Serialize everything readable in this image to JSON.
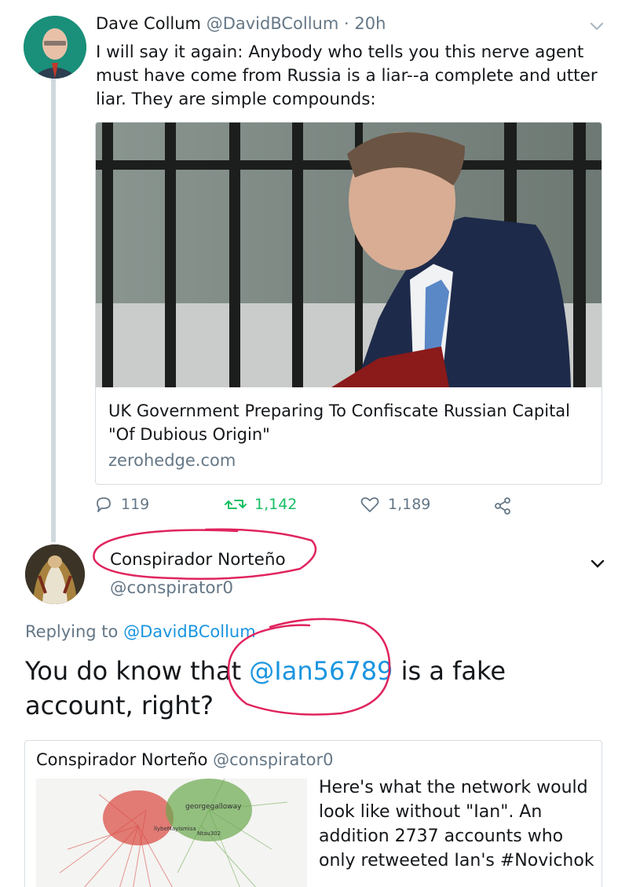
{
  "tweet": {
    "author_name": "Dave Collum",
    "author_handle": "@DavidBCollum",
    "dot": "·",
    "time": "20h",
    "text": "I will say it again: Anybody who tells you this nerve agent must have come from Russia is a liar--a complete and utter liar. They are simple compounds:",
    "card": {
      "title": "UK Government Preparing To Confiscate Russian Capital \"Of Dubious Origin\"",
      "domain": "zerohedge.com"
    },
    "actions": {
      "replies": "119",
      "retweets": "1,142",
      "likes": "1,189"
    }
  },
  "reply": {
    "author_name": "Conspirador Norteño",
    "author_handle": "@conspirator0",
    "replying_label": "Replying to ",
    "replying_handle": "@DavidBCollum",
    "text_before": "You do know that ",
    "mention": "@Ian56789",
    "text_after": " is a fake account, right?",
    "quoted": {
      "author_name": "Conspirador Norteño",
      "author_handle": "@conspirator0",
      "text": "Here's what the network would look like without \"Ian\". An addition 2737 accounts who only retweeted Ian's #Novichok",
      "image_labels": [
        "georgegalloway",
        "llybeMayIsmisa",
        "Ntau302"
      ]
    }
  },
  "colors": {
    "link": "#1b95e0",
    "muted": "#657786",
    "retweet": "#17bf63",
    "annotation": "#e0245e"
  }
}
